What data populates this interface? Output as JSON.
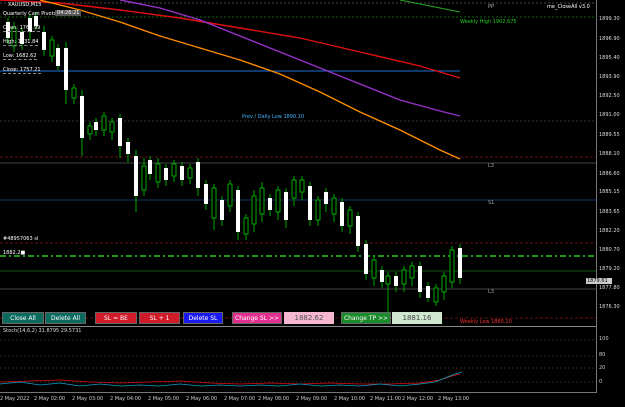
{
  "header": {
    "symbol": "XAUUSD,M15",
    "pivots_title": "Quarterly Cam Pivots",
    "pivots_badge": "04:26:21",
    "open": "Open: 1769.99",
    "high": "High: 1831.84",
    "low": "Low: 1682.62",
    "close": "Close: 1757.21",
    "ea_name": "me_CloseAll v3.0",
    "pp_tag": "PP",
    "weekly_high": "Weekly High 1902.675",
    "prev_daily_low": "Prev / Daily Low 1890.10",
    "l3_top": "L3",
    "s1": "S1",
    "l3_bottom": "L3",
    "weekly_low": "Weekly Low 1880.10",
    "order_label": "#48957063 sl",
    "order_left": "1882.2■"
  },
  "price_axis": [
    "1899.30",
    "1896.90",
    "1895.40",
    "1893.90",
    "1892.50",
    "1891.00",
    "1889.55",
    "1888.10",
    "1886.60",
    "1885.15",
    "1883.65",
    "1882.20",
    "1880.70",
    "1879.20",
    "1877.80",
    "1876.30"
  ],
  "price_badge": "1879.61",
  "toolbar": {
    "close_all": "Close All",
    "delete_all": "Delete All",
    "sl_be": "SL = BE",
    "sl_plus": "SL + 1",
    "delete_sl": "Delete SL",
    "change_sl": "Change SL >>",
    "sl_value": "1882.62",
    "change_tp": "Change TP >>",
    "tp_value": "1881.16"
  },
  "stoch": {
    "title": "Stoch(14,6,2) 31.8795 29.5731",
    "levels": [
      "100",
      "80",
      "20",
      "0"
    ]
  },
  "time_axis": [
    "2 May 2022",
    "2 May 02:00",
    "2 May 03:00",
    "2 May 04:00",
    "2 May 05:00",
    "2 May 06:00",
    "2 May 07:00",
    "2 May 08:00",
    "2 May 09:00",
    "2 May 10:00",
    "2 May 11:00",
    "2 May 12:00",
    "2 May 13:00"
  ],
  "colors": {
    "bull": "#ffffff",
    "bear": "#00aa00",
    "ma_red": "#e01010",
    "ma_orange": "#ff8c00",
    "ma_purple": "#9932cc",
    "blue_line": "#1e6fd9",
    "green_dash": "#22cc22"
  }
}
